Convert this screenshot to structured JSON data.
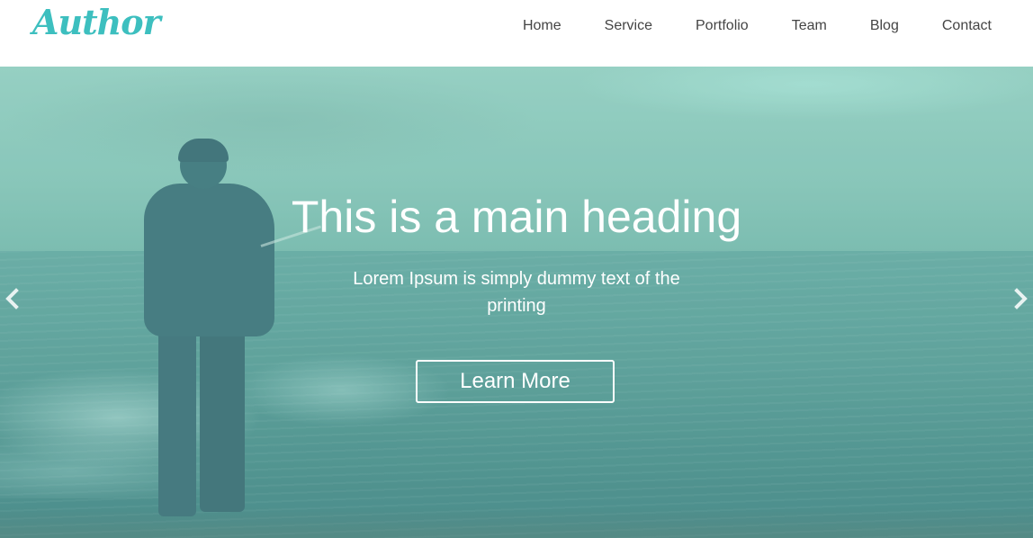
{
  "brand": {
    "logo_text": "Author",
    "accent_color": "#3dbfbf"
  },
  "nav": {
    "items": [
      {
        "label": "Home"
      },
      {
        "label": "Service"
      },
      {
        "label": "Portfolio"
      },
      {
        "label": "Team"
      },
      {
        "label": "Blog"
      },
      {
        "label": "Contact"
      }
    ]
  },
  "hero": {
    "title": "This is a main heading",
    "subtitle": "Lorem Ipsum is simply dummy text of the printing",
    "button_label": "Learn More",
    "overlay_color": "#6ec8b9",
    "prev_icon": "chevron-left-icon",
    "next_icon": "chevron-right-icon"
  }
}
